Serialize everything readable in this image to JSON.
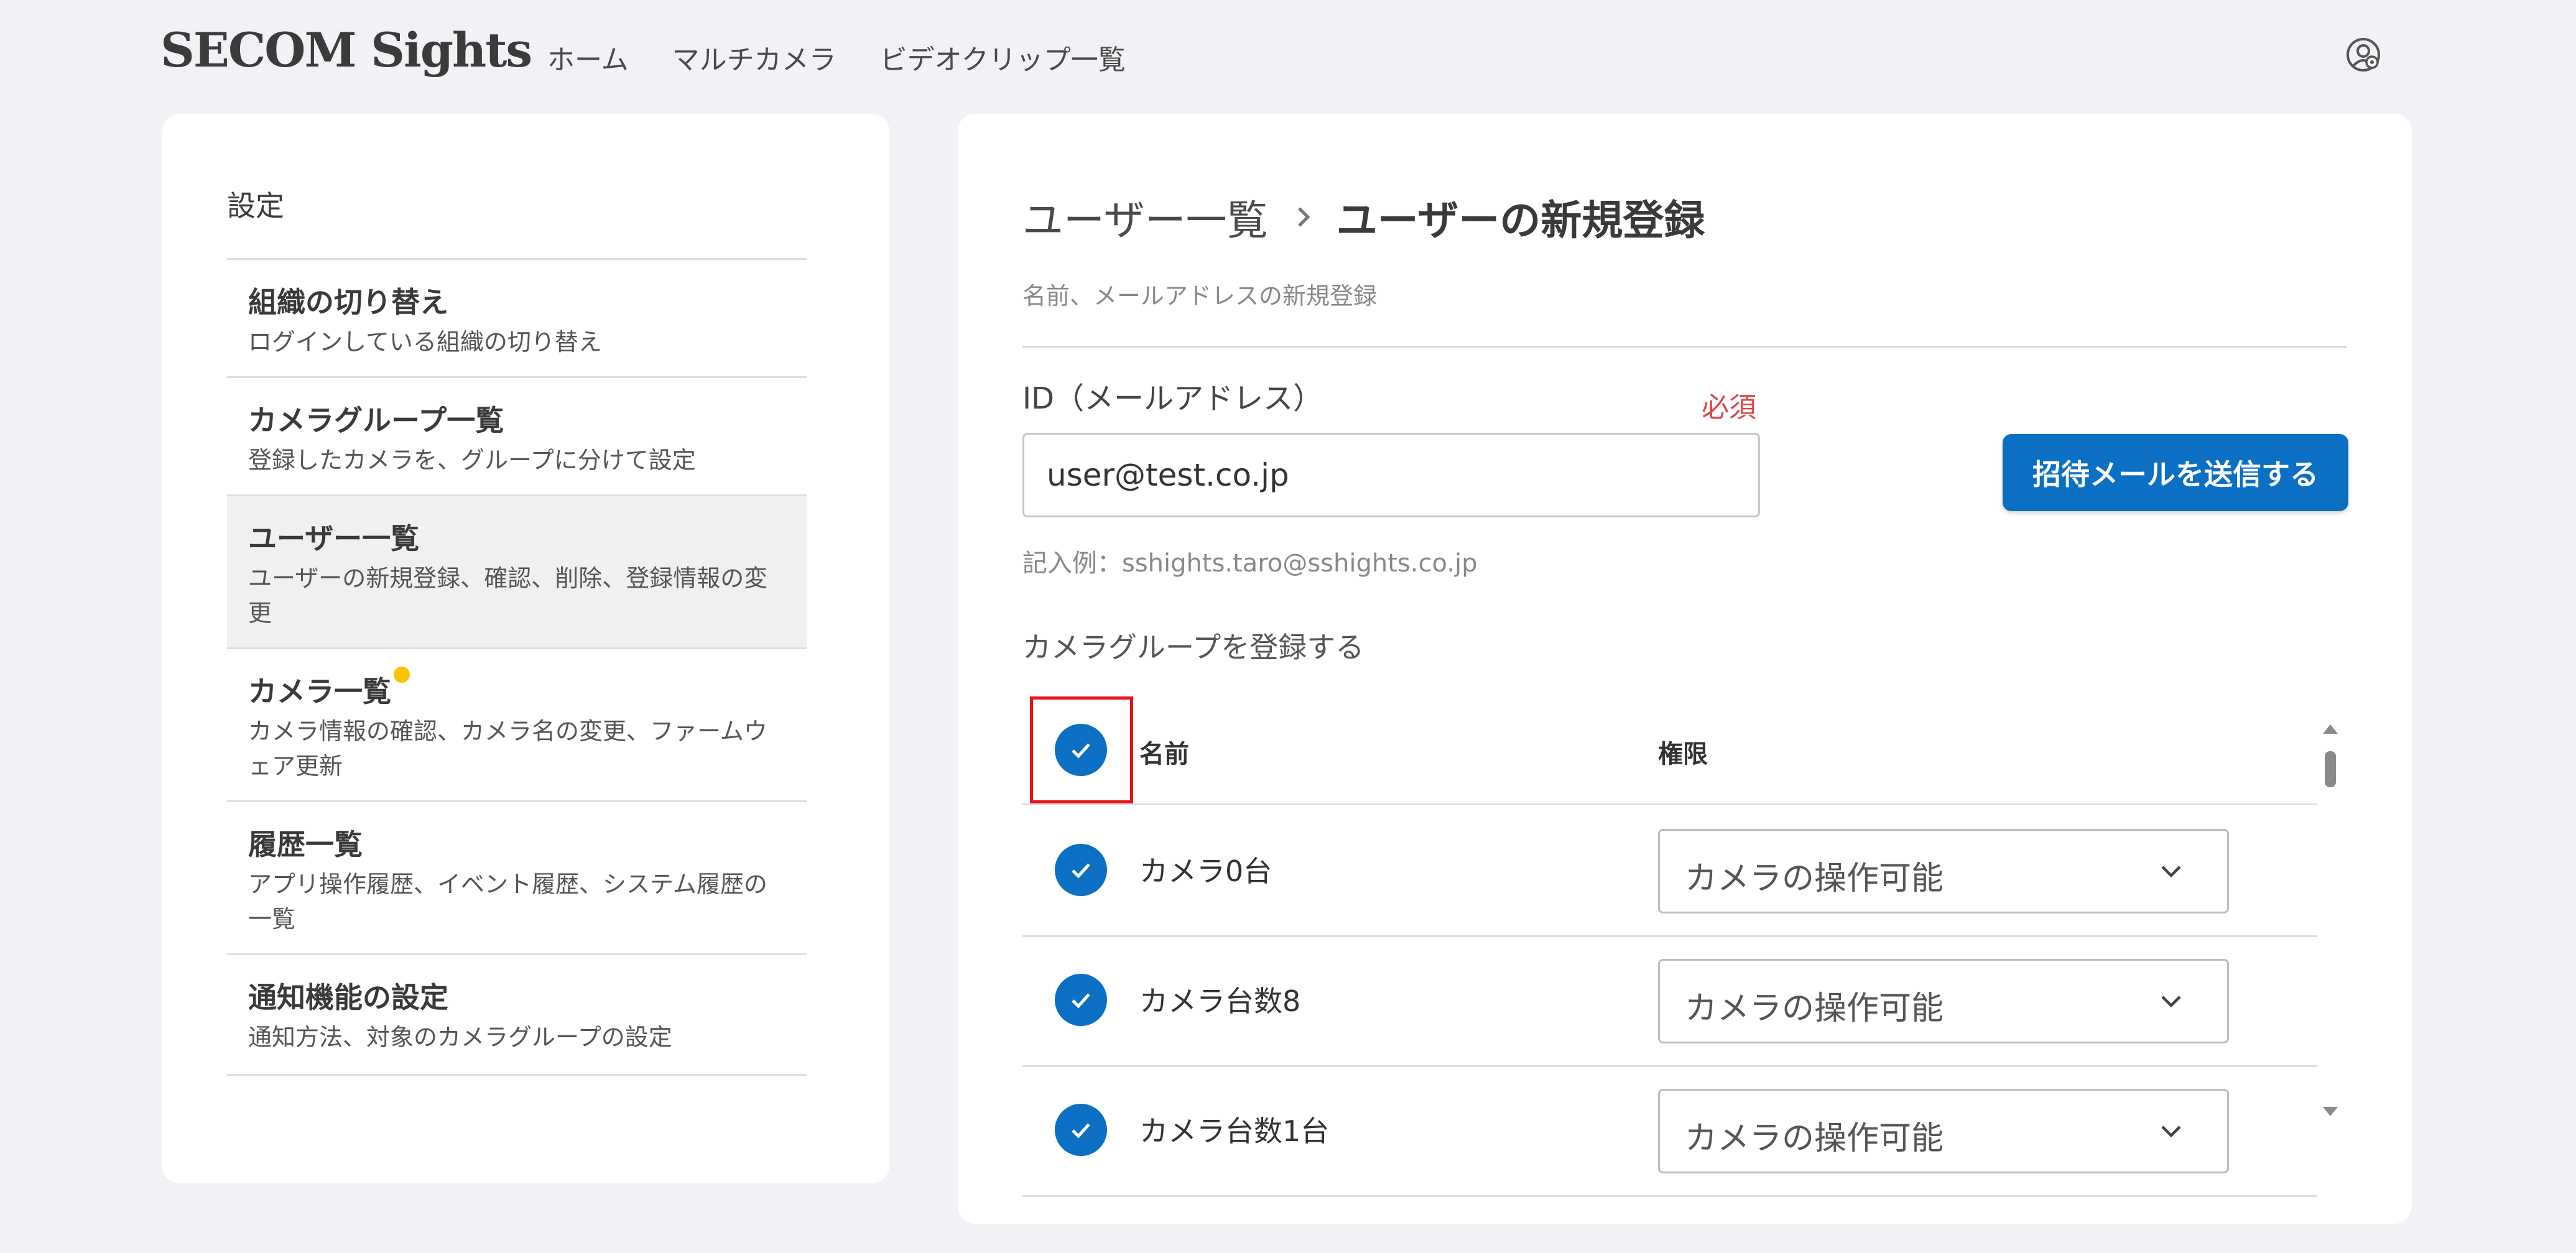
{
  "header": {
    "brand": "SECOM Sights",
    "nav": [
      "ホーム",
      "マルチカメラ",
      "ビデオクリップ一覧"
    ],
    "user_icon": "user-gear-icon"
  },
  "sidebar": {
    "title": "設定",
    "items": [
      {
        "title": "組織の切り替え",
        "desc": "ログインしている組織の切り替え",
        "active": false
      },
      {
        "title": "カメラグループ一覧",
        "desc": "登録したカメラを、グループに分けて設定",
        "active": false
      },
      {
        "title": "ユーザー一覧",
        "desc": "ユーザーの新規登録、確認、削除、登録情報の変更",
        "active": true
      },
      {
        "title": "カメラ一覧",
        "desc": "カメラ情報の確認、カメラ名の変更、ファームウェア更新",
        "active": false,
        "badge": true
      },
      {
        "title": "履歴一覧",
        "desc": "アプリ操作履歴、イベント履歴、システム履歴の一覧",
        "active": false
      },
      {
        "title": "通知機能の設定",
        "desc": "通知方法、対象のカメラグループの設定",
        "active": false
      }
    ]
  },
  "main": {
    "breadcrumb": {
      "parent": "ユーザー一覧",
      "current": "ユーザーの新規登録"
    },
    "description": "名前、メールアドレスの新規登録",
    "id_field": {
      "label": "ID（メールアドレス）",
      "required": "必須",
      "value": "user@test.co.jp",
      "example": "記入例：sshights.taro@sshights.co.jp"
    },
    "invite_button": "招待メールを送信する",
    "camera_group_title": "カメラグループを登録する",
    "table": {
      "headers": {
        "name": "名前",
        "permission": "権限"
      },
      "select_all_checked": true,
      "rows": [
        {
          "name": "カメラ0台",
          "permission": "カメラの操作可能",
          "checked": true
        },
        {
          "name": "カメラ台数8",
          "permission": "カメラの操作可能",
          "checked": true
        },
        {
          "name": "カメラ台数1台",
          "permission": "カメラの操作可能",
          "checked": true
        }
      ]
    }
  },
  "colors": {
    "accent": "#0b6fc3",
    "required": "#e04545",
    "badge": "#f6c500",
    "highlight": "#e5131a",
    "background": "#f1f2f6"
  }
}
